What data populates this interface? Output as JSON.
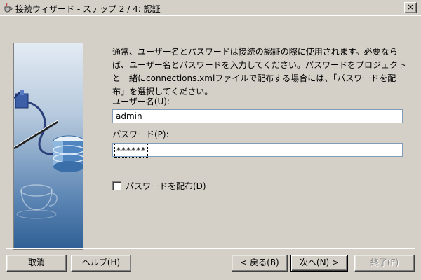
{
  "window": {
    "title": "接続ウィザード - ステップ 2 / 4: 認証",
    "close_glyph": "×"
  },
  "main": {
    "description": "通常、ユーザー名とパスワードは接続の認証の際に使用されます。必要ならば、ユーザー名とパスワードを入力してください。パスワードをプロジェクトと一緒にconnections.xmlファイルで配布する場合には、「パスワードを配布」を選択してください。",
    "username_label": "ユーザー名(U):",
    "username_value": "admin",
    "password_label": "パスワード(P):",
    "password_value": "******",
    "distribute_password_label": "パスワードを配布(D)",
    "distribute_password_checked": false
  },
  "buttons": {
    "cancel": "取消",
    "help": "ヘルプ(H)",
    "back": "< 戻る(B)",
    "next": "次へ(N) >",
    "finish": "終了(F)"
  },
  "colors": {
    "dialog_bg": "#d4d0c8",
    "art_dark_blue": "#2f5f95"
  }
}
